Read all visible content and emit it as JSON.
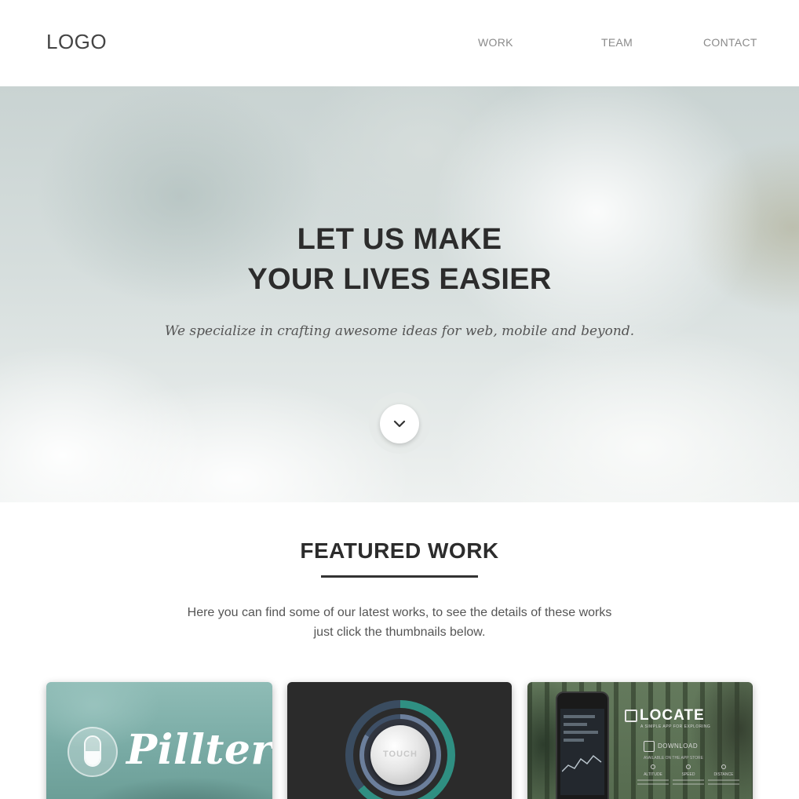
{
  "header": {
    "logo": "LOGO",
    "nav": {
      "work": "WORK",
      "team": "TEAM",
      "contact": "CONTACT"
    }
  },
  "hero": {
    "title_line1": "LET US MAKE",
    "title_line2": "YOUR LIVES EASIER",
    "subtitle": "We specialize in crafting awesome ideas for web, mobile and beyond.",
    "scroll_icon": "chevron-down-icon"
  },
  "featured": {
    "title": "FEATURED WORK",
    "description_line1": "Here you can find some of our latest works, to see the details of these works",
    "description_line2": "just click the thumbnails below."
  },
  "works": [
    {
      "name": "Pillter",
      "accent": "#7fb1aa",
      "icon": "pill-icon"
    },
    {
      "name": "TOUCH",
      "accent": "#2f8f82",
      "icon": "touch-dial-icon"
    },
    {
      "name": "LOCATE",
      "tagline": "A SIMPLE APP FOR EXPLORING",
      "download": "DOWNLOAD",
      "download_sub": "AVAILABLE ON THE APP STORE",
      "features": [
        "ALTITUDE",
        "SPEED",
        "DISTANCE"
      ],
      "accent": "#4d6247",
      "icon": "phone-icon"
    }
  ],
  "colors": {
    "heading": "#2c2c2c",
    "nav": "#8a8a8a",
    "body_text": "#555555"
  }
}
